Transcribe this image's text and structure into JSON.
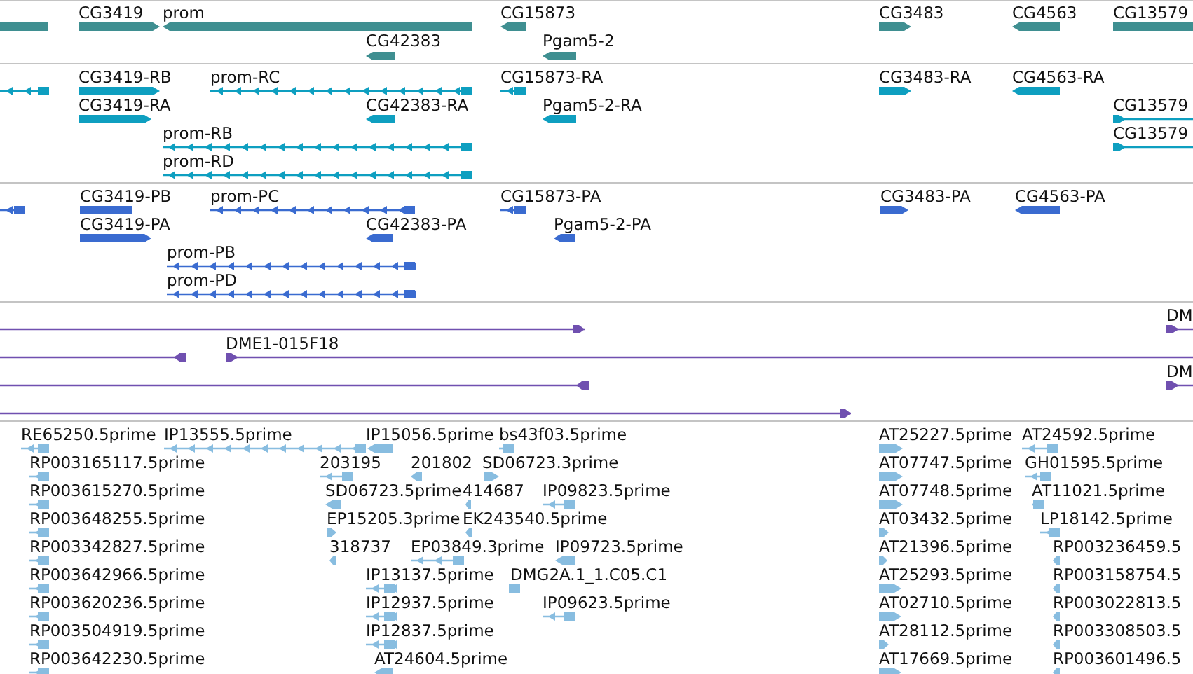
{
  "tracks": [
    {
      "color": "#3f8f91",
      "features": [
        {
          "kind": "plain"
        },
        {
          "label": "CG3419",
          "kind": "forward"
        },
        {
          "label": "prom",
          "kind": "reverse"
        },
        {
          "label": "CG42383",
          "kind": "reverse"
        },
        {
          "label": "CG15873",
          "kind": "reverse"
        },
        {
          "label": "Pgam5-2",
          "kind": "reverse"
        },
        {
          "label": "CG3483",
          "kind": "forward"
        },
        {
          "label": "CG4563",
          "kind": "reverse"
        },
        {
          "label": "CG13579",
          "kind": "plain"
        }
      ]
    },
    {
      "color": "#0e9fc0",
      "features": [
        {
          "kind": "reverse"
        },
        {
          "label": "CG3419-RB",
          "kind": "forward"
        },
        {
          "label": "prom-RC",
          "kind": "reverse"
        },
        {
          "label": "CG15873-RA",
          "kind": "reverse"
        },
        {
          "label": "CG3483-RA",
          "kind": "forward"
        },
        {
          "label": "CG4563-RA",
          "kind": "reverse"
        },
        {
          "label": "CG3419-RA",
          "kind": "forward"
        },
        {
          "label": "CG42383-RA",
          "kind": "reverse"
        },
        {
          "label": "Pgam5-2-RA",
          "kind": "reverse"
        },
        {
          "label": "CG13579",
          "kind": "forward"
        },
        {
          "label": "prom-RB",
          "kind": "reverse"
        },
        {
          "label": "CG13579",
          "kind": "forward"
        },
        {
          "label": "prom-RD",
          "kind": "reverse"
        }
      ]
    },
    {
      "color": "#3a6bd0",
      "features": [
        {
          "kind": "reverse"
        },
        {
          "label": "CG3419-PB",
          "kind": "plain"
        },
        {
          "label": "prom-PC",
          "kind": "reverse"
        },
        {
          "label": "CG15873-PA",
          "kind": "reverse"
        },
        {
          "label": "CG3483-PA",
          "kind": "forward"
        },
        {
          "label": "CG4563-PA",
          "kind": "reverse"
        },
        {
          "label": "CG3419-PA",
          "kind": "forward"
        },
        {
          "label": "CG42383-PA",
          "kind": "reverse"
        },
        {
          "label": "Pgam5-2-PA",
          "kind": "reverse"
        },
        {
          "label": "prom-PB",
          "kind": "reverse"
        },
        {
          "label": "prom-PD",
          "kind": "reverse"
        }
      ]
    },
    {
      "color": "#7050b0",
      "features": [
        {
          "kind": "forward"
        },
        {
          "label": "DM",
          "kind": "forward"
        },
        {
          "kind": "reverse"
        },
        {
          "label": "DME1-015F18",
          "kind": "forward"
        },
        {
          "kind": "reverse"
        },
        {
          "label": "DM",
          "kind": "forward"
        },
        {
          "kind": "forward"
        }
      ]
    },
    {
      "color": "#88bde0",
      "features": [
        {
          "label": "RE65250.5prime",
          "kind": "reverse"
        },
        {
          "label": "IP13555.5prime",
          "kind": "reverse"
        },
        {
          "label": "IP15056.5prime",
          "kind": "reverse"
        },
        {
          "label": "bs43f03.5prime",
          "kind": "reverse"
        },
        {
          "label": "AT25227.5prime",
          "kind": "forward"
        },
        {
          "label": "AT24592.5prime",
          "kind": "reverse"
        },
        {
          "label": "RP003165117.5prime",
          "kind": "reverse"
        },
        {
          "label": "203195",
          "kind": "reverse"
        },
        {
          "label": "201802",
          "kind": "reverse"
        },
        {
          "label": "SD06723.3prime",
          "kind": "forward"
        },
        {
          "label": "AT07747.5prime",
          "kind": "forward"
        },
        {
          "label": "GH01595.5prime",
          "kind": "reverse"
        },
        {
          "label": "RP003615270.5prime",
          "kind": "reverse"
        },
        {
          "label": "SD06723.5prime",
          "kind": "reverse"
        },
        {
          "label": "414687",
          "kind": "reverse"
        },
        {
          "label": "IP09823.5prime",
          "kind": "reverse"
        },
        {
          "label": "AT07748.5prime",
          "kind": "forward"
        },
        {
          "label": "AT11021.5prime",
          "kind": "reverse"
        },
        {
          "label": "RP003648255.5prime",
          "kind": "reverse"
        },
        {
          "label": "EP15205.3prime",
          "kind": "forward"
        },
        {
          "label": "EK243540.5prime",
          "kind": "reverse"
        },
        {
          "label": "AT03432.5prime",
          "kind": "forward"
        },
        {
          "label": "LP18142.5prime",
          "kind": "reverse"
        },
        {
          "label": "RP003342827.5prime",
          "kind": "reverse"
        },
        {
          "label": "318737",
          "kind": "reverse"
        },
        {
          "label": "EP03849.3prime",
          "kind": "reverse"
        },
        {
          "label": "IP09723.5prime",
          "kind": "reverse"
        },
        {
          "label": "AT21396.5prime",
          "kind": "forward"
        },
        {
          "label": "RP003236459.5",
          "kind": "reverse"
        },
        {
          "label": "RP003642966.5prime",
          "kind": "reverse"
        },
        {
          "label": "IP13137.5prime",
          "kind": "reverse"
        },
        {
          "label": "DMG2A.1_1.C05.C1",
          "kind": "reverse"
        },
        {
          "label": "AT25293.5prime",
          "kind": "forward"
        },
        {
          "label": "RP003158754.5",
          "kind": "reverse"
        },
        {
          "label": "RP003620236.5prime",
          "kind": "reverse"
        },
        {
          "label": "IP12937.5prime",
          "kind": "reverse"
        },
        {
          "label": "IP09623.5prime",
          "kind": "reverse"
        },
        {
          "label": "AT02710.5prime",
          "kind": "forward"
        },
        {
          "label": "RP003022813.5",
          "kind": "reverse"
        },
        {
          "label": "RP003504919.5prime",
          "kind": "reverse"
        },
        {
          "label": "IP12837.5prime",
          "kind": "reverse"
        },
        {
          "label": "AT28112.5prime",
          "kind": "forward"
        },
        {
          "label": "RP003308503.5",
          "kind": "reverse"
        },
        {
          "label": "RP003642230.5prime",
          "kind": "reverse"
        },
        {
          "label": "AT24604.5prime",
          "kind": "reverse"
        },
        {
          "label": "AT17669.5prime",
          "kind": "forward"
        },
        {
          "label": "RP003601496.5",
          "kind": "reverse"
        }
      ]
    }
  ]
}
